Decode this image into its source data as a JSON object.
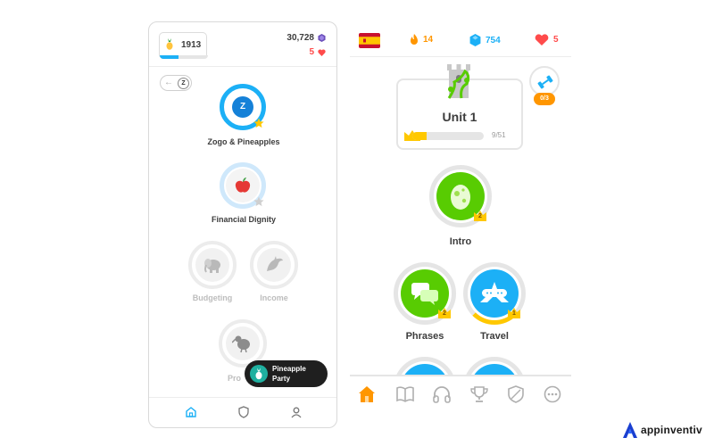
{
  "left_screen": {
    "pineapples": {
      "count": "1913",
      "progress_fraction": 0.38
    },
    "gems": {
      "count": "30,728"
    },
    "hearts": {
      "count": "5"
    },
    "toggle": {
      "arrow": "←",
      "knob": "Z"
    },
    "skills": [
      {
        "label": "Zogo & Pineapples",
        "state": "active",
        "icon": "zogo-z-icon"
      },
      {
        "label": "Financial Dignity",
        "state": "in-progress",
        "icon": "apple-icon"
      },
      {
        "label": "Budgeting",
        "state": "locked",
        "icon": "elephant-icon"
      },
      {
        "label": "Income",
        "state": "locked",
        "icon": "dolphin-icon"
      },
      {
        "label": "Pro",
        "state": "locked",
        "icon": "kiwi-bird-icon"
      }
    ],
    "toast": {
      "line1": "Pineapple",
      "line2": "Party",
      "icon": "pineapple-icon"
    },
    "nav": [
      "home-icon",
      "shield-icon",
      "profile-icon"
    ]
  },
  "right_screen": {
    "flag": "spain-flag-icon",
    "streak": {
      "count": "14",
      "color": "#ff9600"
    },
    "gems": {
      "count": "754",
      "color": "#1cb0f6"
    },
    "hearts": {
      "count": "5",
      "color": "#ff4b4b"
    },
    "unit": {
      "title": "Unit 1",
      "progress": "9/51",
      "progress_fraction": 0.2
    },
    "challenge_badge": "0/3",
    "lessons": [
      {
        "label": "Intro",
        "crown": "2",
        "icon": "egg-icon"
      },
      {
        "label": "Phrases",
        "crown": "2",
        "icon": "chat-bubbles-icon"
      },
      {
        "label": "Travel",
        "crown": "1",
        "icon": "airplane-icon"
      }
    ],
    "nav": [
      "home-icon",
      "book-icon",
      "headphones-icon",
      "trophy-icon",
      "shield-icon",
      "more-icon"
    ]
  },
  "brand": {
    "name": "appinventiv"
  },
  "colors": {
    "green": "#58cc02",
    "blue": "#1cb0f6",
    "gold": "#ffc800",
    "grey": "#e5e5e5"
  }
}
